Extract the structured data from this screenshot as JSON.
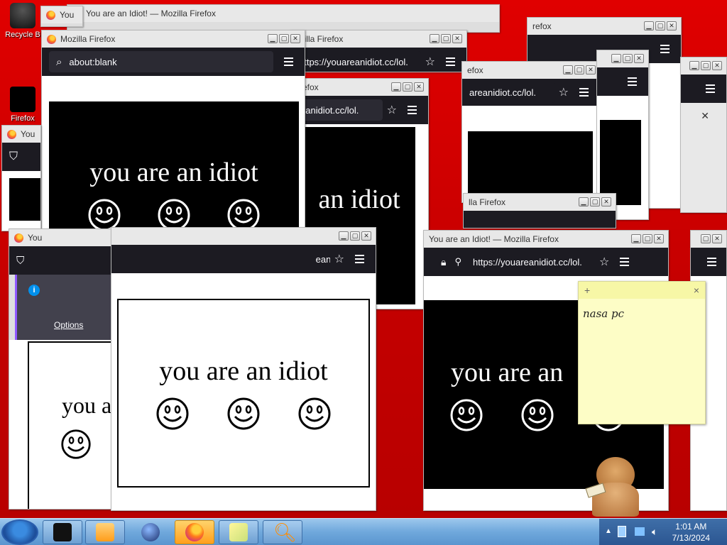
{
  "desktop": {
    "icons": [
      {
        "label": "Recycle B"
      },
      {
        "label": "Firefox"
      }
    ]
  },
  "windows": {
    "top_title": "You are an Idiot! — Mozilla Firefox",
    "main_title": "Mozilla Firefox",
    "main_url": "about:blank",
    "title_firefox": "Mozilla Firefox",
    "title_you": "You are an Idiot! — Mozilla Firefox",
    "url_short": "https://youareanidiot.cc/lol.",
    "url_partial": "eanidiot.cc/lol.",
    "url_partial2": "areanidiot.cc/lol.",
    "url_right": "https://youareanidiot.cc/lol.",
    "options_label": "Options",
    "idiot_text": "you are an idiot",
    "idiot_text_partial": "an idiot",
    "idiot_text_partial2": "you are an",
    "idiot_text_partial3": "you a",
    "title_fox": "efox",
    "title_fox2": "refox",
    "title_ozilla": "ozilla Firefox",
    "title_lla": "lla Firefox",
    "title_you_short": "You"
  },
  "sticky": {
    "add_label": "+",
    "close_label": "×",
    "text": "nasa pc"
  },
  "taskbar": {
    "time": "1:01 AM",
    "date": "7/13/2024"
  },
  "colors": {
    "desktop": "#d40000",
    "firefox_toolbar": "#1c1b22",
    "taskbar": "#6fa8dc",
    "sticky": "#fdfdc6"
  }
}
